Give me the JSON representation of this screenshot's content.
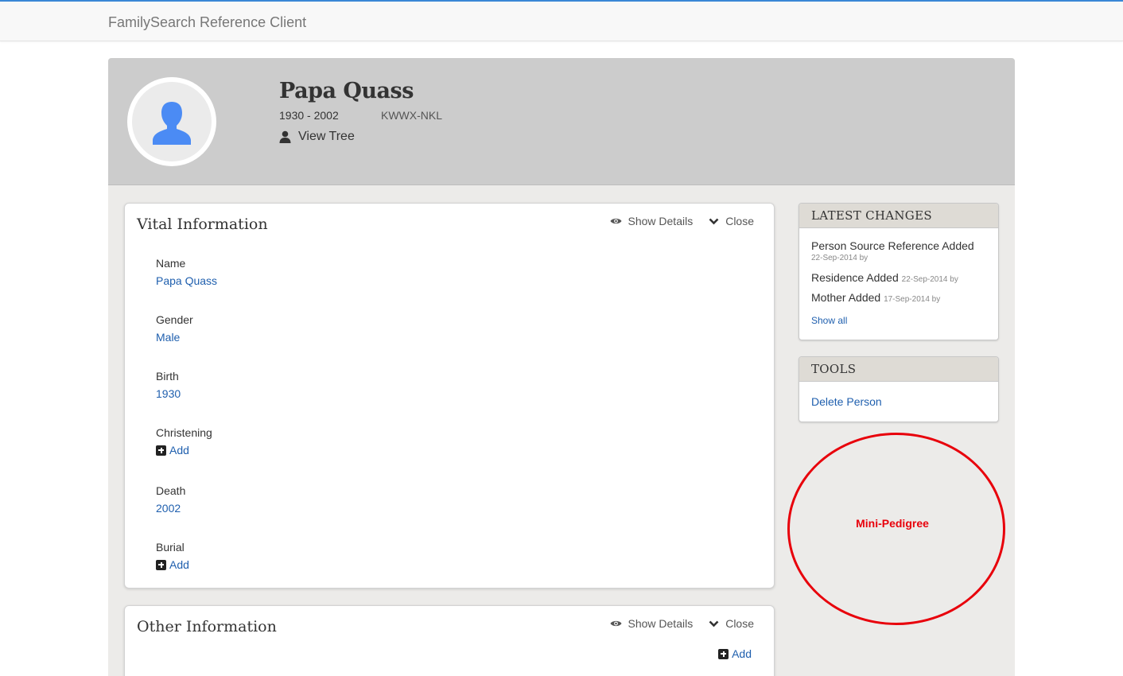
{
  "app": {
    "title": "FamilySearch Reference Client"
  },
  "person": {
    "name": "Papa Quass",
    "lifespan": "1930 - 2002",
    "id": "KWWX-NKL",
    "view_tree_label": "View Tree"
  },
  "vital": {
    "title": "Vital Information",
    "show_details": "Show Details",
    "close": "Close",
    "fields": [
      {
        "label": "Name",
        "value": "Papa Quass"
      },
      {
        "label": "Gender",
        "value": "Male"
      },
      {
        "label": "Birth",
        "value": "1930"
      },
      {
        "label": "Christening",
        "value": "Add"
      },
      {
        "label": "Death",
        "value": "2002"
      },
      {
        "label": "Burial",
        "value": "Add"
      }
    ]
  },
  "other": {
    "title": "Other Information",
    "show_details": "Show Details",
    "close": "Close",
    "add": "Add"
  },
  "latest_changes": {
    "title": "LATEST CHANGES",
    "items": [
      {
        "text": "Person Source Reference Added",
        "meta": "22-Sep-2014 by"
      },
      {
        "text": "Residence Added",
        "meta": "22-Sep-2014 by"
      },
      {
        "text": "Mother Added",
        "meta": "17-Sep-2014 by"
      }
    ],
    "show_all": "Show all"
  },
  "tools": {
    "title": "TOOLS",
    "delete_person": "Delete Person"
  },
  "mini_pedigree": {
    "label": "Mini-Pedigree"
  },
  "colors": {
    "link": "#1f5fae",
    "accent_border": "#3a87d6",
    "annotation_red": "#e8000b",
    "avatar_blue": "#4b8bf4"
  },
  "icons": {
    "avatar": "person-silhouette-icon",
    "view_tree": "user-icon",
    "show_details": "eye-icon",
    "close": "chevron-down-icon",
    "add": "plus-square-icon"
  }
}
